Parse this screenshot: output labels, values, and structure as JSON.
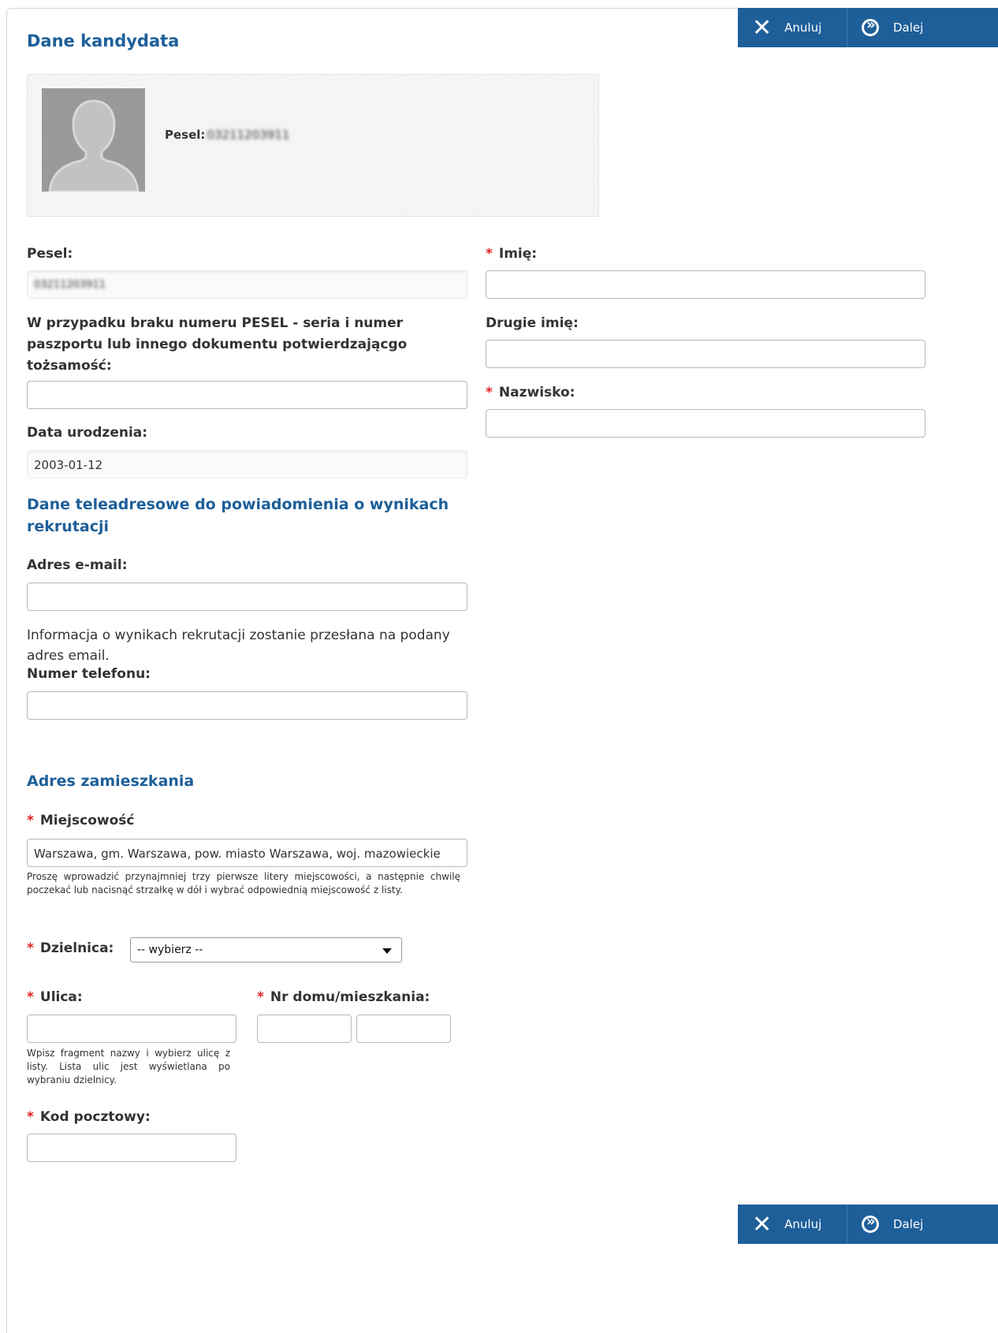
{
  "header": {
    "title": "Dane kandydata",
    "cancel_label": "Anuluj",
    "next_label": "Dalej"
  },
  "profile": {
    "pesel_label": "Pesel:",
    "pesel_value": "03211203911"
  },
  "form": {
    "pesel_label": "Pesel:",
    "pesel_value": "03211203911",
    "passport_label": "W przypadku braku numeru PESEL - seria i numer paszportu lub innego dokumentu potwierdzającgo tożsamość:",
    "passport_value": "",
    "birth_label": "Data urodzenia:",
    "birth_value": "2003-01-12",
    "first_name_label": "Imię:",
    "second_name_label": "Drugie imię:",
    "surname_label": "Nazwisko:",
    "required_mark": "*"
  },
  "contact": {
    "heading": "Dane teleadresowe do powiadomienia o wynikach rekrutacji",
    "email_label": "Adres e-mail:",
    "email_info": "Informacja o wynikach rekrutacji zostanie przesłana na podany adres email.",
    "phone_label": "Numer telefonu:"
  },
  "address": {
    "heading": "Adres zamieszkania",
    "city_label": "Miejscowość",
    "city_value": "Warszawa, gm. Warszawa, pow. miasto Warszawa, woj. mazowieckie",
    "city_hint": "Proszę wprowadzić przynajmniej trzy pierwsze litery miejscowości, a następnie chwilę poczekać lub nacisnąć strzałkę w dół i wybrać odpowiednią miejscowość z listy.",
    "district_label": "Dzielnica:",
    "district_value": "-- wybierz --",
    "street_label": "Ulica:",
    "street_hint": "Wpisz fragment nazwy i wybierz ulicę z listy. Lista ulic jest wyświetlana po wybraniu dzielnicy.",
    "house_label": "Nr domu/mieszkania:",
    "postal_label": "Kod pocztowy:"
  },
  "footer": {
    "cancel_label": "Anuluj",
    "next_label": "Dalej"
  },
  "colors": {
    "accent": "#1d5f99",
    "button_bg": "#1e5f9a",
    "required": "#e02020"
  }
}
